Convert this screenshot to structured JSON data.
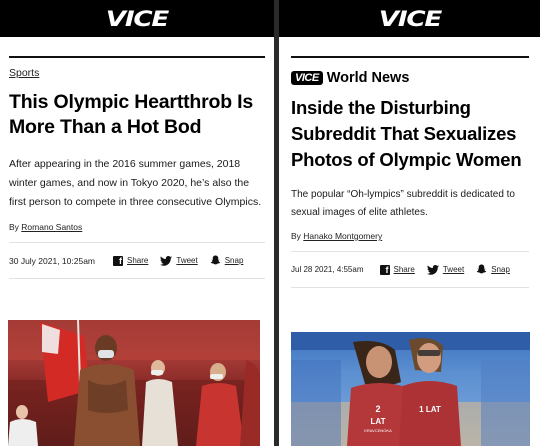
{
  "left": {
    "logo": "VICE",
    "section": "Sports",
    "headline": "This Olympic Heartthrob Is More Than a Hot Bod",
    "dek": "After appearing in the 2016 summer games, 2018 winter games, and now in Tokyo 2020, he’s also the first person to compete in three consecutive Olympics.",
    "byline_prefix": "By",
    "author": "Romano Santos",
    "date": "30 July 2021, 10:25am",
    "share": {
      "facebook": "Share",
      "twitter": "Tweet",
      "snapchat": "Snap"
    }
  },
  "right": {
    "logo": "VICE",
    "brand_logo": "VICE",
    "brand_section": "World News",
    "headline": "Inside the Disturbing Subreddit That Sexualizes Photos of Olympic Women",
    "dek": "The popular “Oh-lympics” subreddit is dedicated to sexual images of elite athletes.",
    "byline_prefix": "By",
    "author": "Hanako Montgomery",
    "date": "Jul 28 2021, 4:55am",
    "share": {
      "facebook": "Share",
      "twitter": "Tweet",
      "snapchat": "Snap"
    },
    "photo_jersey_left": "2",
    "photo_jersey_left_country": "LAT",
    "photo_jersey_left_name": "KRAVCENOKA",
    "photo_jersey_right": "1 LAT"
  },
  "colors": {
    "topbar": "#000000",
    "text": "#000000",
    "left_photo": "#a53a35",
    "right_photo": "#5b8fd0"
  }
}
